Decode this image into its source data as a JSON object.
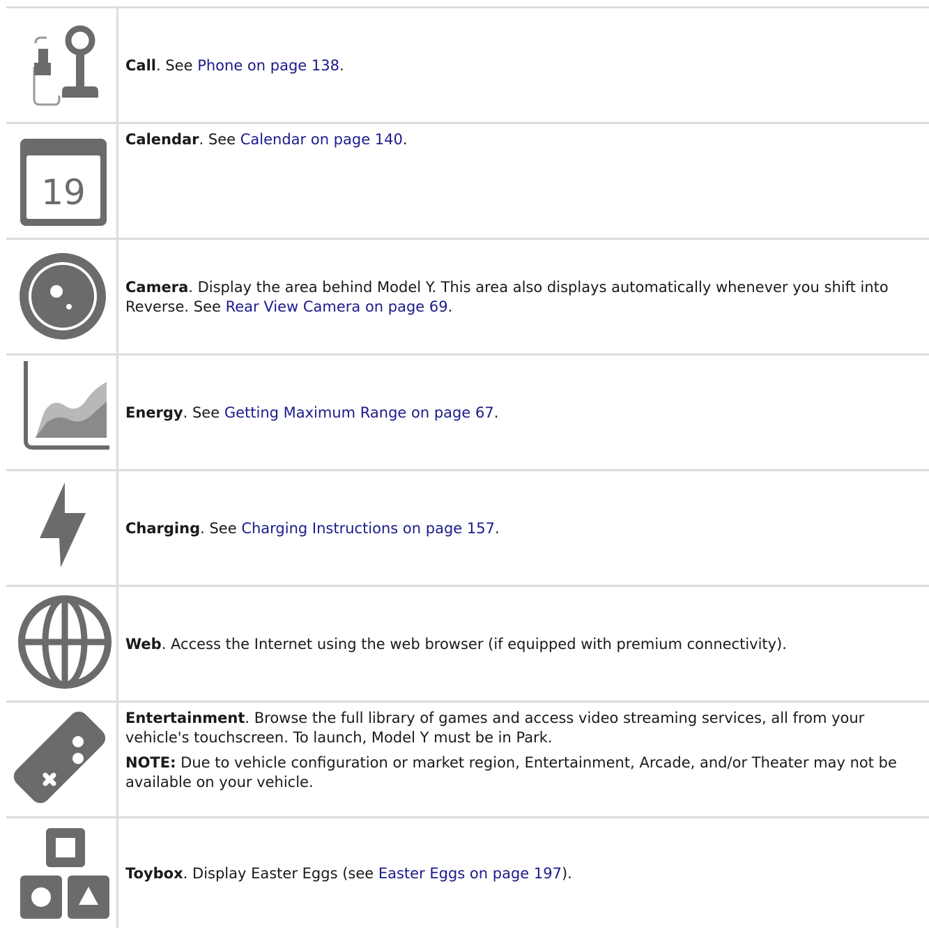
{
  "rows": [
    {
      "term": "Call",
      "pre": ". See ",
      "link": "Phone on page 138",
      "post": "."
    },
    {
      "term": "Calendar",
      "pre": ". See ",
      "link": "Calendar on page 140",
      "post": ".",
      "calendar_day": "19"
    },
    {
      "term": "Camera",
      "pre": ". Display the area behind Model Y. This area also displays automatically whenever you shift into Reverse. See ",
      "link": "Rear View Camera on page 69",
      "post": "."
    },
    {
      "term": "Energy",
      "pre": ". See ",
      "link": "Getting Maximum Range on page 67",
      "post": "."
    },
    {
      "term": "Charging",
      "pre": ". See ",
      "link": "Charging Instructions on page 157",
      "post": "."
    },
    {
      "term": "Web",
      "pre": ". Access the Internet using the web browser (if equipped with premium connectivity)."
    },
    {
      "term": "Entertainment",
      "pre": ". Browse the full library of games and access video streaming services, all from your vehicle's touchscreen. To launch, Model Y must be in Park.",
      "note_label": "NOTE:",
      "note_text": " Due to vehicle configuration or market region, Entertainment, Arcade, and/or Theater may not be available on your vehicle."
    },
    {
      "term": "Toybox",
      "pre": ". Display Easter Eggs (see ",
      "link": "Easter Eggs on page 197",
      "post": ")."
    }
  ],
  "colors": {
    "icon": "#6b6b6b",
    "link": "#1b1b8c",
    "border": "#dcdcdc"
  }
}
